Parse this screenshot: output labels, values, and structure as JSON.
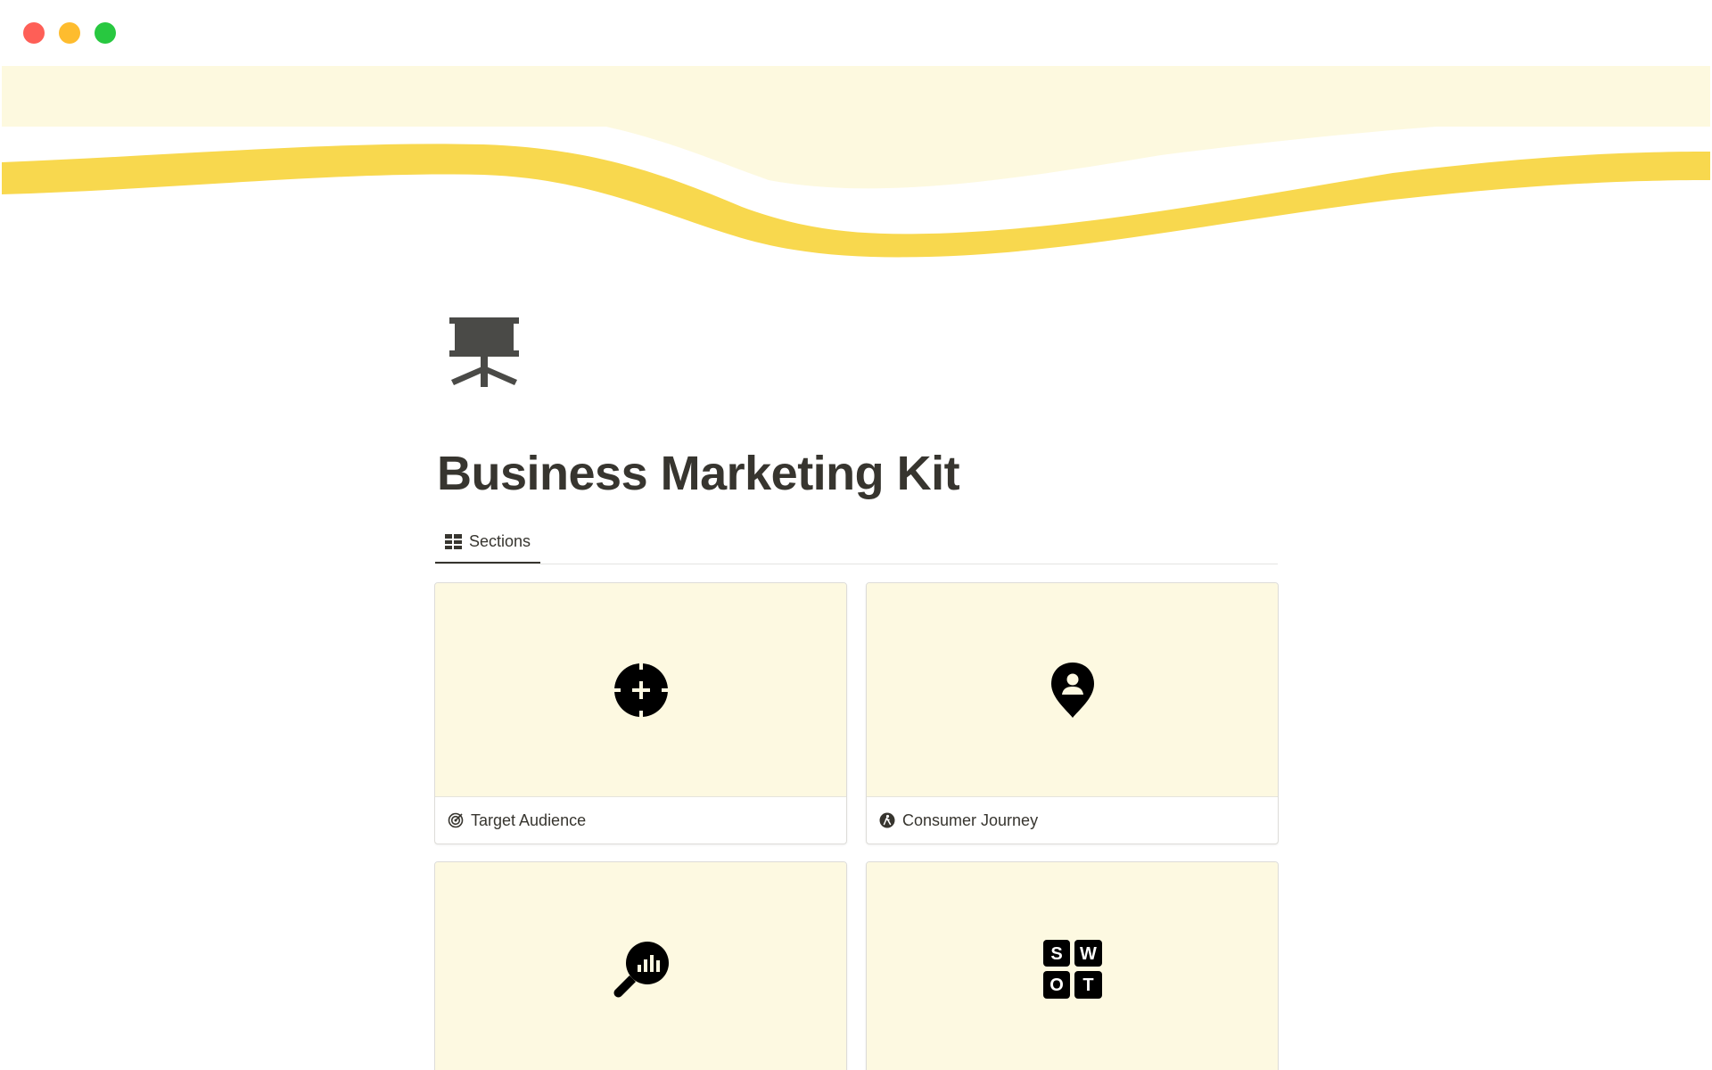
{
  "window": {
    "controls": [
      "close",
      "minimize",
      "maximize"
    ]
  },
  "colors": {
    "cover_light": "#fdf9df",
    "cover_stripe": "#f8d84e",
    "card_cover": "#fdf9e1",
    "text": "#37352f",
    "icon_dark": "#4a4a47"
  },
  "page": {
    "icon": "presentation-board-icon",
    "title": "Business Marketing Kit"
  },
  "tabs": [
    {
      "label": "Sections",
      "icon": "gallery-grid-icon",
      "active": true
    }
  ],
  "cards": [
    {
      "title": "Target Audience",
      "cover_icon": "crosshair-plus-icon",
      "small_icon": "target-icon"
    },
    {
      "title": "Consumer Journey",
      "cover_icon": "location-person-pin-icon",
      "small_icon": "walking-person-icon"
    },
    {
      "title": "",
      "cover_icon": "analytics-magnifier-icon",
      "small_icon": ""
    },
    {
      "title": "",
      "cover_icon": "swot-grid-icon",
      "small_icon": ""
    }
  ]
}
